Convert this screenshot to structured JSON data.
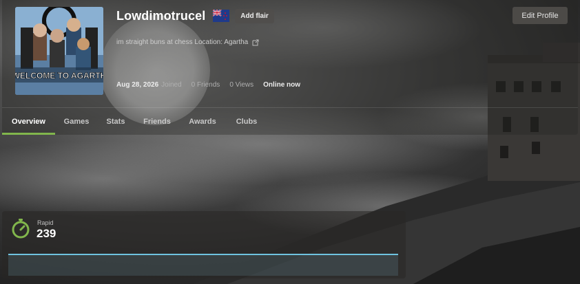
{
  "profile": {
    "username": "Lowdimotrucel",
    "flair_button": "Add flair",
    "edit_button": "Edit Profile",
    "bio": "im straight buns at chess Location: Agartha",
    "avatar_text": "WELCOME TO AGARTH",
    "joined_date": "Aug 28, 2026",
    "joined_label": "Joined",
    "friends": "0 Friends",
    "views": "0 Views",
    "status": "Online now",
    "flag_icon": "new-zealand-flag-icon"
  },
  "tabs": [
    {
      "label": "Overview",
      "active": true
    },
    {
      "label": "Games",
      "active": false
    },
    {
      "label": "Stats",
      "active": false
    },
    {
      "label": "Friends",
      "active": false
    },
    {
      "label": "Awards",
      "active": false
    },
    {
      "label": "Clubs",
      "active": false
    }
  ],
  "rating": {
    "type": "Rapid",
    "value": "239",
    "icon": "stopwatch-icon",
    "accent": "#81b64c",
    "chart_color": "#6fc3e0"
  },
  "colors": {
    "active_tab_underline": "#81b64c"
  }
}
